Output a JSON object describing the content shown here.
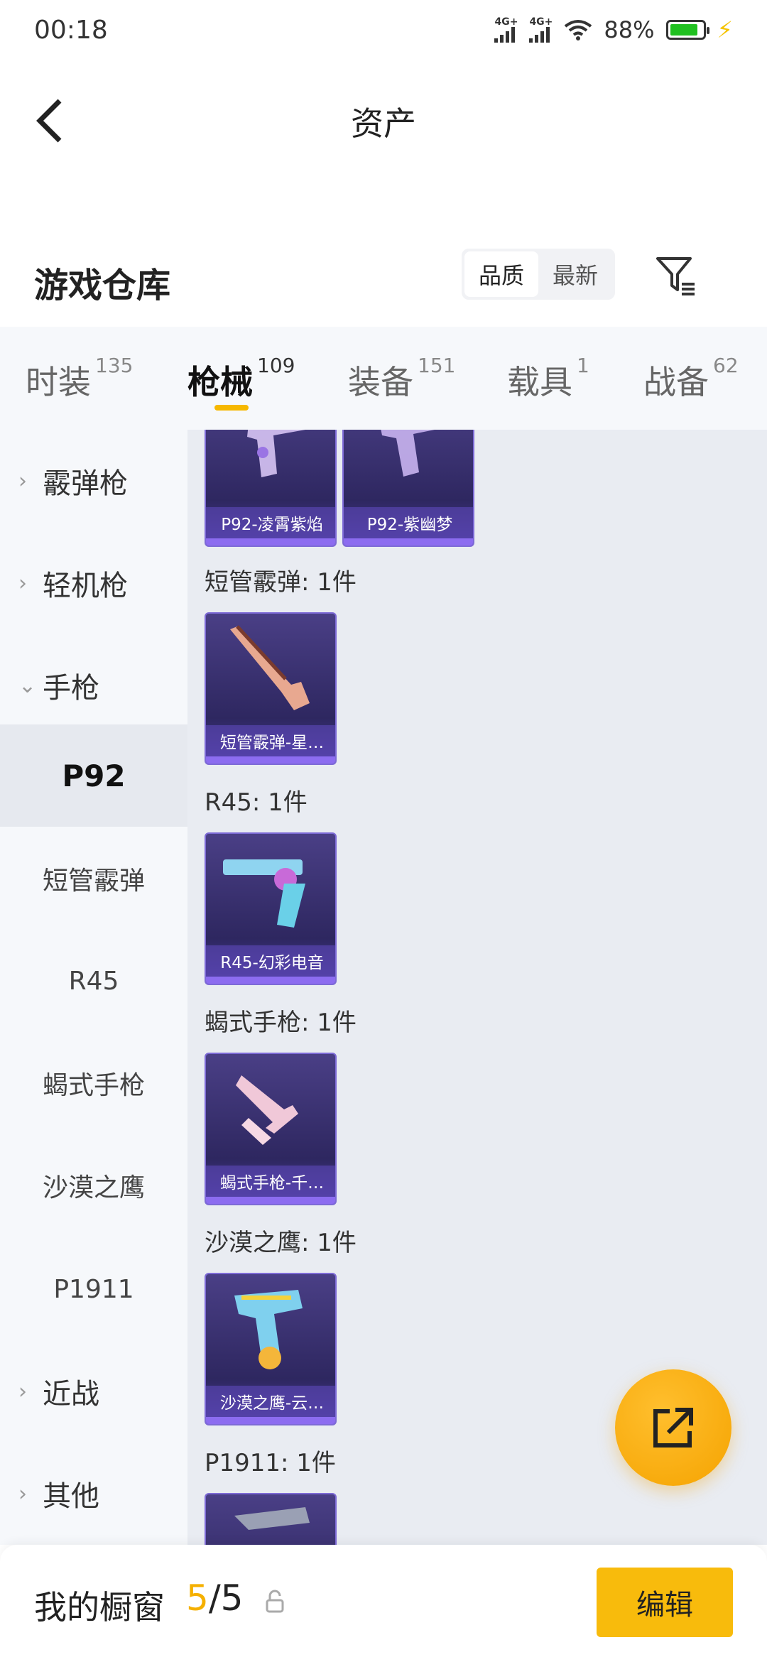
{
  "status_bar": {
    "time": "00:18",
    "signal_1_label": "4G+",
    "signal_2_label": "4G+",
    "battery_percent": "88%",
    "battery_level": 0.88,
    "battery_color": "#20c020"
  },
  "header": {
    "title": "资产",
    "back_icon": "back-arrow"
  },
  "warehouse": {
    "title": "游戏仓库",
    "sort_options": [
      "品质",
      "最新"
    ],
    "sort_selected": "品质",
    "filter_icon": "filter-icon"
  },
  "tabs": [
    {
      "label": "时装",
      "count": "135",
      "active": false
    },
    {
      "label": "枪械",
      "count": "109",
      "active": true
    },
    {
      "label": "装备",
      "count": "151",
      "active": false
    },
    {
      "label": "载具",
      "count": "1",
      "active": false
    },
    {
      "label": "战备",
      "count": "62",
      "active": false
    }
  ],
  "sidebar": {
    "categories": [
      {
        "label": "霰弹枪",
        "expanded": false
      },
      {
        "label": "轻机枪",
        "expanded": false
      },
      {
        "label": "手枪",
        "expanded": true
      }
    ],
    "pistol_subitems": [
      {
        "label": "P92",
        "active": true
      },
      {
        "label": "短管霰弹",
        "active": false
      },
      {
        "label": "R45",
        "active": false
      },
      {
        "label": "蝎式手枪",
        "active": false
      },
      {
        "label": "沙漠之鹰",
        "active": false
      },
      {
        "label": "P1911",
        "active": false
      }
    ],
    "more_categories": [
      {
        "label": "近战",
        "expanded": false
      },
      {
        "label": "其他",
        "expanded": false
      }
    ]
  },
  "groups": [
    {
      "title": "",
      "items": [
        {
          "name": "P92-凌霄紫焰"
        },
        {
          "name": "P92-紫幽梦"
        }
      ]
    },
    {
      "title": "短管霰弹: 1件",
      "items": [
        {
          "name": "短管霰弹-星…"
        }
      ]
    },
    {
      "title": "R45: 1件",
      "items": [
        {
          "name": "R45-幻彩电音"
        }
      ]
    },
    {
      "title": "蝎式手枪: 1件",
      "items": [
        {
          "name": "蝎式手枪-千…"
        }
      ]
    },
    {
      "title": "沙漠之鹰: 1件",
      "items": [
        {
          "name": "沙漠之鹰-云…"
        }
      ]
    },
    {
      "title": "P1911: 1件",
      "items": [
        {
          "name": ""
        }
      ]
    }
  ],
  "fab": {
    "icon": "share-icon",
    "color": "#f5a300"
  },
  "bottom_bar": {
    "label": "我的橱窗",
    "current": "5",
    "separator": "/",
    "total": "5",
    "lock_icon": "lock-icon",
    "edit_label": "编辑",
    "edit_color": "#f8bb0c"
  },
  "accent_color": "#f6b800"
}
